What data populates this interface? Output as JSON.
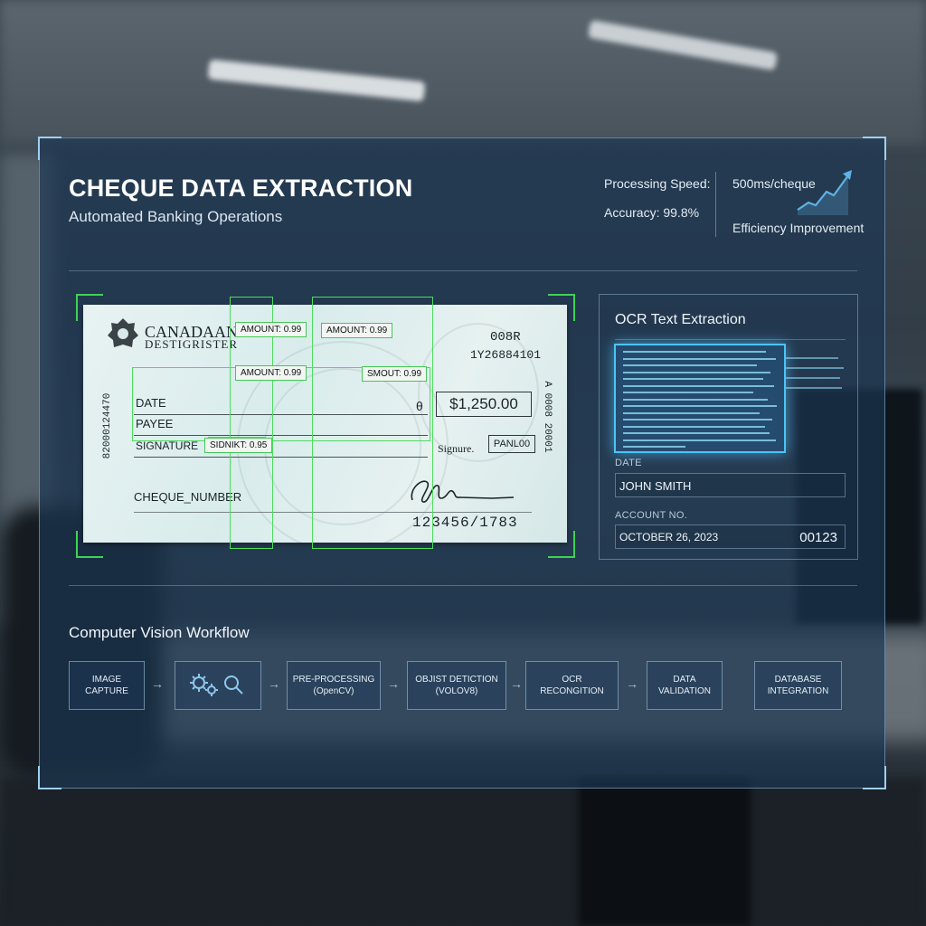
{
  "header": {
    "title": "CHEQUE DATA EXTRACTION",
    "subtitle": "Automated Banking Operations"
  },
  "metrics": {
    "processing_speed_label": "Processing Speed:",
    "accuracy": "Accuracy: 99.8%",
    "speed_value": "500ms/cheque",
    "efficiency_label": "Efficiency Improvement"
  },
  "cheque": {
    "bank_name": "CANADAAN",
    "bank_sub": "DESTIGRISTER",
    "top_code": "008R",
    "top_number": "1Y26884101",
    "date_label": "DATE",
    "payee_label": "PAYEE",
    "signature_label": "SIGNATURE",
    "cheque_number_label": "CHEQUE_NUMBER",
    "amount": "$1,250.00",
    "amount_marker": "θ",
    "signature_text": "Signure.",
    "panl_tag": "PANL00",
    "micr": "123456/1783",
    "left_vertical": "82000124470",
    "right_vertical": "A 0008 20001"
  },
  "detections": [
    "AMOUNT: 0.99",
    "AMOUNT: 0.99",
    "AMOUNT: 0.99",
    "SMOUT: 0.99",
    "SIDNIKT: 0.95"
  ],
  "ocr": {
    "title": "OCR Text Extraction",
    "date_label": "DATE",
    "name_value": "JOHN SMITH",
    "account_label": "ACCOUNT NO.",
    "date_value": "OCTOBER 26, 2023",
    "account_value": "00123"
  },
  "workflow": {
    "title": "Computer Vision Workflow",
    "steps": [
      "IMAGE\nCAPTURE",
      "",
      "PRE-PROCESSING\n(OpenCV)",
      "OBJIST DETICTION\n(VOLOV8)",
      "OCR\nRECONGITION",
      "DATA\nVALIDATION",
      "DATABASE\nINTEGRATION"
    ],
    "arrow": "→"
  },
  "colors": {
    "detection_green": "#4fdc5f",
    "ocr_glow": "#4ec3f5",
    "panel": "#1c3652"
  }
}
